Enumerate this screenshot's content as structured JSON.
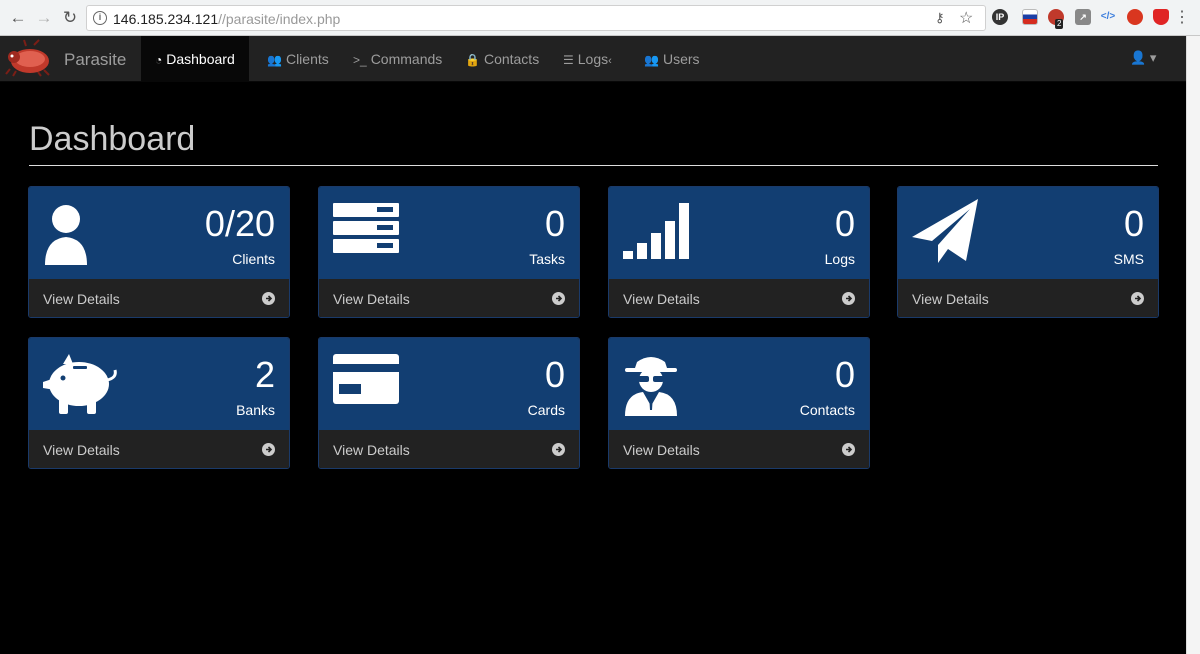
{
  "browser": {
    "url_host": "146.185.234.121",
    "url_path": "//parasite/index.php"
  },
  "navbar": {
    "brand": "Parasite",
    "items": [
      {
        "label": "Dashboard",
        "icon": "dashboard-icon",
        "active": true
      },
      {
        "label": "Clients",
        "icon": "users-icon",
        "active": false
      },
      {
        "label": "Commands",
        "icon": "terminal-icon",
        "active": false
      },
      {
        "label": "Contacts",
        "icon": "lock-icon",
        "active": false
      },
      {
        "label": "Logs",
        "icon": "list-icon",
        "active": false
      },
      {
        "label": "Users",
        "icon": "users-icon",
        "active": false
      }
    ]
  },
  "page": {
    "title": "Dashboard"
  },
  "panels": [
    {
      "count": "0/20",
      "label": "Clients",
      "icon": "user-icon",
      "footer": "View Details"
    },
    {
      "count": "0",
      "label": "Tasks",
      "icon": "server-icon",
      "footer": "View Details"
    },
    {
      "count": "0",
      "label": "Logs",
      "icon": "signal-icon",
      "footer": "View Details"
    },
    {
      "count": "0",
      "label": "SMS",
      "icon": "paper-plane-icon",
      "footer": "View Details"
    },
    {
      "count": "2",
      "label": "Banks",
      "icon": "piggy-bank-icon",
      "footer": "View Details"
    },
    {
      "count": "0",
      "label": "Cards",
      "icon": "credit-card-icon",
      "footer": "View Details"
    },
    {
      "count": "0",
      "label": "Contacts",
      "icon": "spy-icon",
      "footer": "View Details"
    }
  ],
  "colors": {
    "panel_head": "#123e72",
    "panel_foot": "#222222",
    "navbar": "#222222",
    "page_bg": "#000000"
  }
}
